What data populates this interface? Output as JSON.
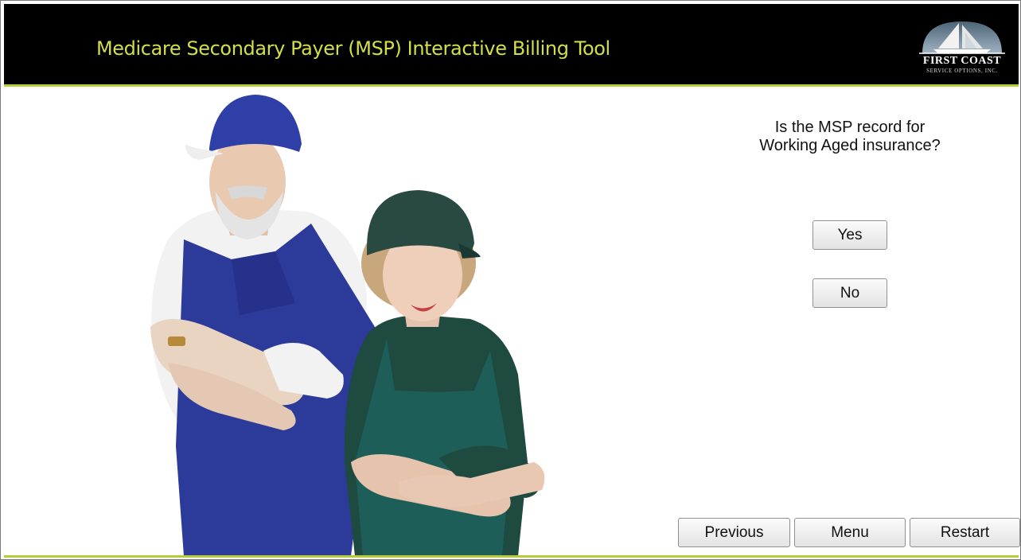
{
  "header": {
    "title": "Medicare Secondary Payer (MSP) Interactive Billing Tool",
    "logo_name": "FIRST COAST",
    "logo_sub": "SERVICE OPTIONS, INC.",
    "title_color": "#d4de49",
    "accent_color": "#b7cc3a"
  },
  "question": {
    "line1": "Is the MSP record for",
    "line2": "Working Aged insurance?"
  },
  "answers": {
    "yes_label": "Yes",
    "no_label": "No"
  },
  "nav": {
    "previous_label": "Previous",
    "menu_label": "Menu",
    "restart_label": "Restart"
  },
  "photo": {
    "icon": "two-seniors-photo"
  }
}
